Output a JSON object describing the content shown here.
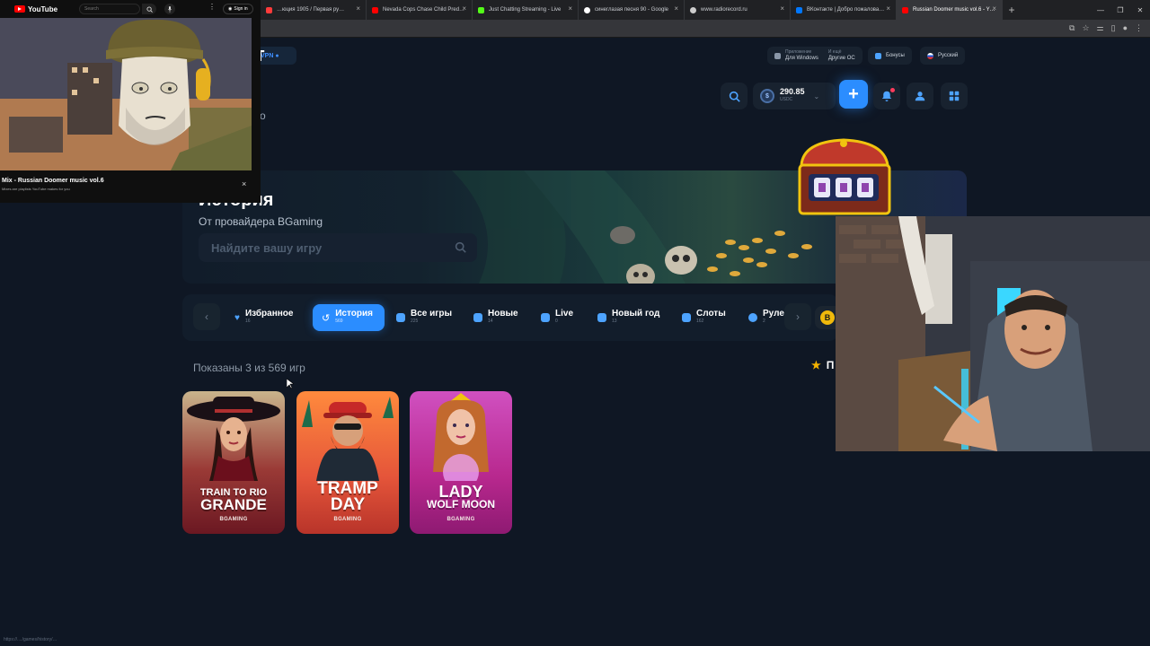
{
  "browser": {
    "tabs": [
      {
        "label": "…юция 1905 / Первая ру…",
        "color": "#ff3b3b"
      },
      {
        "label": "Nevada Cops Chase Child Pred…",
        "color": "#ff0000"
      },
      {
        "label": "Just Chatting Streaming - Live",
        "color": "#53fc18"
      },
      {
        "label": "синеглазая песня 90 - Google",
        "color": "#ffffff"
      },
      {
        "label": "www.radiorecord.ru",
        "color": "#cccccc"
      },
      {
        "label": "ВКонтакте | Добро пожалова…",
        "color": "#0077ff"
      },
      {
        "label": "Russian Doomer music vol.6 - Y…",
        "color": "#ff0000"
      }
    ],
    "new_tab": "+",
    "status_url": "https://..../games/history/…"
  },
  "youtube_mini": {
    "brand": "YouTube",
    "search_placeholder": "Search",
    "signin": "Sign in",
    "title": "Mix - Russian Doomer music vol.6",
    "subtitle": "Mixes are playlists YouTube makes for you",
    "close": "×"
  },
  "topbar": {
    "vpn": "VPN",
    "download_top": "Приложение",
    "download_bottom": "Для Windows",
    "other_top": "И ещё",
    "other_bottom": "Другие ОС",
    "bonuses": "Бонусы",
    "language": "Русский"
  },
  "header": {
    "logo_fragment": "т",
    "sub_fragment": "о",
    "balance_amount": "290.85",
    "balance_currency": "USDC",
    "plus": "+"
  },
  "banner": {
    "title": "История",
    "subtitle": "От провайдера BGaming",
    "search_placeholder": "Найдите вашу игру"
  },
  "categories": [
    {
      "name": "Избранное",
      "count": "16",
      "color": "#4da3ff",
      "active": false
    },
    {
      "name": "История",
      "count": "569",
      "color": "#ffffff",
      "active": true
    },
    {
      "name": "Все игры",
      "count": "225",
      "color": "#4da3ff",
      "active": false
    },
    {
      "name": "Новые",
      "count": "14",
      "color": "#4da3ff",
      "active": false
    },
    {
      "name": "Live",
      "count": "0",
      "color": "#4da3ff",
      "active": false
    },
    {
      "name": "Новый год",
      "count": "13",
      "color": "#4da3ff",
      "active": false
    },
    {
      "name": "Слоты",
      "count": "162",
      "color": "#4da3ff",
      "active": false
    },
    {
      "name": "Руле…",
      "count": "2",
      "color": "#4da3ff",
      "active": false
    }
  ],
  "nav": {
    "prev": "‹",
    "next": "›",
    "b_chip": "B"
  },
  "results": {
    "shown": "Показаны 3 из 569 игр",
    "favorites_fragment": "П"
  },
  "games": [
    {
      "title_line1": "TRAIN TO RIO",
      "title_line2": "GRANDE",
      "provider": "BGAMING",
      "bg": "#7a1e2a"
    },
    {
      "title_line1": "TRAMP",
      "title_line2": "DAY",
      "provider": "BGAMING",
      "bg": "#d84a2a"
    },
    {
      "title_line1": "LADY",
      "title_line2": "WOLF MOON",
      "provider": "BGAMING",
      "bg": "#c0318f"
    }
  ]
}
